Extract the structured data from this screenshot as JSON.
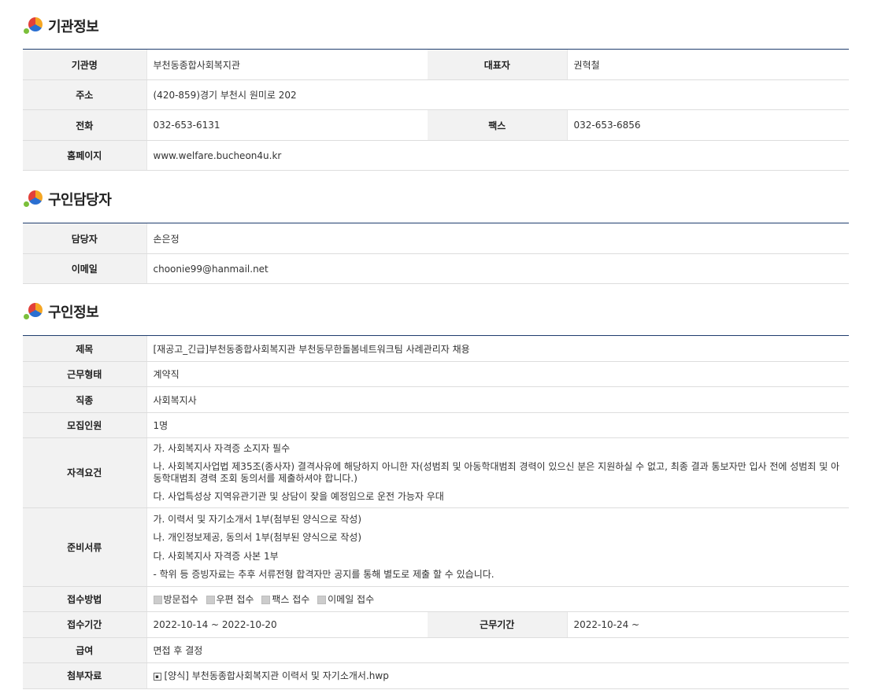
{
  "sections": {
    "org": {
      "title": "기관정보",
      "name_label": "기관명",
      "name_value": "부천동종합사회복지관",
      "rep_label": "대표자",
      "rep_value": "권혁철",
      "addr_label": "주소",
      "addr_value": "(420-859)경기 부천시 원미로 202",
      "tel_label": "전화",
      "tel_value": "032-653-6131",
      "fax_label": "팩스",
      "fax_value": "032-653-6856",
      "home_label": "홈페이지",
      "home_value": "www.welfare.bucheon4u.kr"
    },
    "contact": {
      "title": "구인담당자",
      "person_label": "담당자",
      "person_value": "손은정",
      "email_label": "이메일",
      "email_value": "choonie99@hanmail.net"
    },
    "job": {
      "title": "구인정보",
      "subject_label": "제목",
      "subject_value": "[재공고_긴급]부천동종합사회복지관 부천동무한돌봄네트워크팀 사례관리자 채용",
      "type_label": "근무형태",
      "type_value": "계약직",
      "category_label": "직종",
      "category_value": "사회복지사",
      "count_label": "모집인원",
      "count_value": "1명",
      "qual_label": "자격요건",
      "qual_lines": [
        "가. 사회복지사 자격증 소지자 필수",
        "나. 사회복지사업법 제35조(종사자) 결격사유에 해당하지 아니한 자(성범죄 및 아동학대범죄 경력이 있으신 분은 지원하실 수 없고, 최종 결과 통보자만 입사 전에 성범죄 및 아동학대범죄 경력 조회 동의서를 제출하셔야 합니다.)",
        "다. 사업특성상 지역유관기관 및 상담이 잦을 예정임으로 운전 가능자 우대"
      ],
      "docs_label": "준비서류",
      "docs_lines": [
        "가. 이력서 및 자기소개서 1부(첨부된 양식으로 작성)",
        "나. 개인정보제공, 동의서 1부(첨부된 양식으로 작성)",
        "다. 사회복지사 자격증 사본 1부",
        "- 학위 등 증빙자료는 추후 서류전형 합격자만 공지를 통해 별도로 제출 할 수 있습니다."
      ],
      "method_label": "접수방법",
      "methods": [
        "방문접수",
        "우편 접수",
        "팩스 접수",
        "이메일 접수"
      ],
      "period_label": "접수기간",
      "period_value": "2022-10-14 ~ 2022-10-20",
      "workterm_label": "근무기간",
      "workterm_value": "2022-10-24 ~",
      "salary_label": "급여",
      "salary_value": "면접 후 결정",
      "attach_label": "첨부자료",
      "attach_value": "[양식] 부천동종합사회복지관 이력서 및 자기소개서.hwp"
    }
  }
}
